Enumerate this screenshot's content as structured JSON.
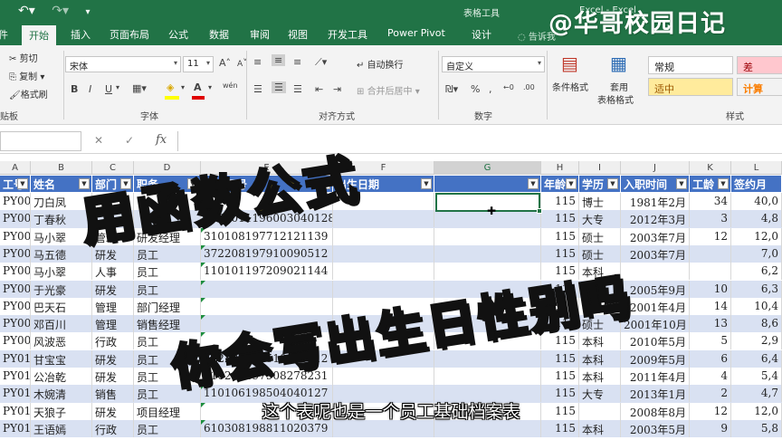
{
  "titlebar": {
    "undo_icon": "undo-icon",
    "redo_icon": "redo-icon",
    "customize_icon": "customize-icon",
    "context_label": "表格工具",
    "window_title": "Excel - Excel"
  },
  "tabs": [
    "件",
    "开始",
    "插入",
    "页面布局",
    "公式",
    "数据",
    "审阅",
    "视图",
    "开发工具",
    "Power Pivot",
    "设计"
  ],
  "active_tab": "开始",
  "tell_me": "告诉我",
  "ribbon": {
    "clipboard": {
      "cut": "剪切",
      "copy": "复制",
      "format_painter": "格式刷",
      "group": "贴板"
    },
    "font": {
      "name": "宋体",
      "size": "11",
      "group": "字体",
      "bold": "B",
      "italic": "I",
      "underline": "U",
      "grow": "A",
      "shrink": "A",
      "wen": "wén",
      "font_color": "A"
    },
    "alignment": {
      "wrap": "自动换行",
      "merge": "合并后居中",
      "group": "对齐方式"
    },
    "number": {
      "format": "自定义",
      "group": "数字"
    },
    "styles": {
      "conditional": "条件格式",
      "table_format_1": "套用",
      "table_format_2": "表格格式",
      "normal": "常规",
      "bad": "差",
      "neutral": "适中",
      "calc": "计算",
      "group": "样式"
    }
  },
  "formula_bar": {
    "cancel": "✕",
    "confirm": "✓",
    "fx": "fx",
    "value": ""
  },
  "columns": [
    "A",
    "B",
    "C",
    "D",
    "E",
    "F",
    "G",
    "H",
    "I",
    "J",
    "K",
    "L"
  ],
  "table": {
    "headers": [
      "工号",
      "姓名",
      "部门",
      "职务",
      "身份证号",
      "出生日期",
      "",
      "年龄",
      "学历",
      "入职时间",
      "工龄",
      "签约月"
    ],
    "rows": [
      [
        "PY001",
        "刀白凤",
        "",
        "",
        "",
        "115",
        "博士",
        "1981年2月",
        "34",
        "40,0"
      ],
      [
        "PY002",
        "丁春秋",
        "",
        "",
        "510101119600304012​8",
        "115",
        "大专",
        "2012年3月",
        "3",
        "4,8"
      ],
      [
        "PY003",
        "马小翠",
        "管理",
        "研发经理",
        "310108197712121139",
        "115",
        "硕士",
        "2003年7月",
        "12",
        "12,0"
      ],
      [
        "PY004",
        "马五德",
        "研发",
        "员工",
        "372208197910090512",
        "115",
        "硕士",
        "2003年7月",
        "",
        "7,0"
      ],
      [
        "PY005",
        "马小翠",
        "人事",
        "员工",
        "110101197209021144",
        "115",
        "本科",
        "",
        "",
        "6,2"
      ],
      [
        "PY006",
        "于光豪",
        "研发",
        "员工",
        "",
        "115",
        "",
        "2005年9月",
        "10",
        "6,3"
      ],
      [
        "PY007",
        "巴天石",
        "管理",
        "部门经理",
        "",
        "115",
        "硕士",
        "2001年4月",
        "14",
        "10,4"
      ],
      [
        "PY008",
        "邓百川",
        "管理",
        "销售经理",
        "",
        "115",
        "硕士",
        "2001年10月",
        "13",
        "8,6"
      ],
      [
        "PY009",
        "风波恶",
        "行政",
        "员工",
        "",
        "115",
        "本科",
        "2010年5月",
        "5",
        "2,9"
      ],
      [
        "PY010",
        "甘宝宝",
        "研发",
        "员工",
        "372208198510070512",
        "115",
        "本科",
        "2009年5月",
        "6",
        "6,4"
      ],
      [
        "PY011",
        "公冶乾",
        "研发",
        "员工",
        "410205197908278231",
        "115",
        "本科",
        "2011年4月",
        "4",
        "5,4"
      ],
      [
        "PY012",
        "木婉清",
        "销售",
        "员工",
        "110106198504040127",
        "115",
        "大专",
        "2013年1月",
        "2",
        "4,7"
      ],
      [
        "PY013",
        "天狼子",
        "研发",
        "项目经理",
        "",
        "115",
        "",
        "2008年8月",
        "12",
        "12,0"
      ],
      [
        "PY014",
        "王语嫣",
        "行政",
        "员工",
        "610308198811020379",
        "115",
        "本科",
        "2003年5月",
        "9",
        "5,8"
      ]
    ]
  },
  "overlay": {
    "watermark": "@华哥校园日记",
    "headline_1": "用函数公式",
    "headline_2": "你会写出生日性别吗",
    "subtitle": "这个表呢也是一个员工基础档案表"
  }
}
